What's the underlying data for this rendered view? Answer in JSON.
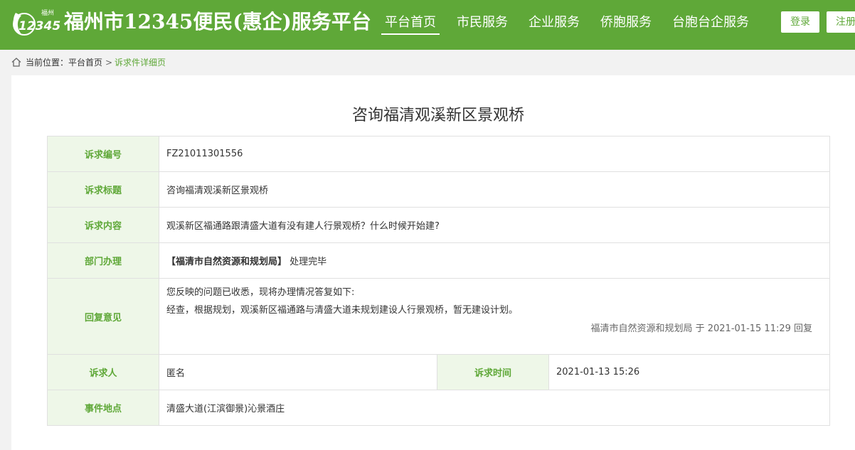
{
  "header": {
    "logo_label": "福州",
    "logo_number": "12345",
    "site_title": "福州市12345便民(惠企)服务平台",
    "nav": [
      {
        "label": "平台首页",
        "active": true
      },
      {
        "label": "市民服务",
        "active": false
      },
      {
        "label": "企业服务",
        "active": false
      },
      {
        "label": "侨胞服务",
        "active": false
      },
      {
        "label": "台胞台企服务",
        "active": false
      }
    ],
    "login_label": "登录",
    "register_label": "注册",
    "brand_color": "#5fa838"
  },
  "breadcrumb": {
    "prefix": "当前位置：",
    "home": "平台首页",
    "separator": ">",
    "current": "诉求件详细页"
  },
  "detail": {
    "title": "咨询福清观溪新区景观桥",
    "rows": {
      "number_label": "诉求编号",
      "number_value": "FZ21011301556",
      "title_label": "诉求标题",
      "title_value": "咨询福清观溪新区景观桥",
      "content_label": "诉求内容",
      "content_value": "观溪新区福通路跟清盛大道有没有建人行景观桥？什么时候开始建?",
      "dept_label": "部门办理",
      "dept_name": "【福清市自然资源和规划局】",
      "dept_status": "处理完毕",
      "reply_label": "回复意见",
      "reply_line1": "您反映的问题已收悉，现将办理情况答复如下:",
      "reply_line2": "经查，根据规划，观溪新区福通路与清盛大道未规划建设人行景观桥，暂无建设计划。",
      "reply_sign": "福清市自然资源和规划局 于 2021-01-15 11:29 回复",
      "person_label": "诉求人",
      "person_value": "匿名",
      "time_label": "诉求时间",
      "time_value": "2021-01-13 15:26",
      "place_label": "事件地点",
      "place_value": "清盛大道(江滨御景)沁景酒庄"
    }
  }
}
